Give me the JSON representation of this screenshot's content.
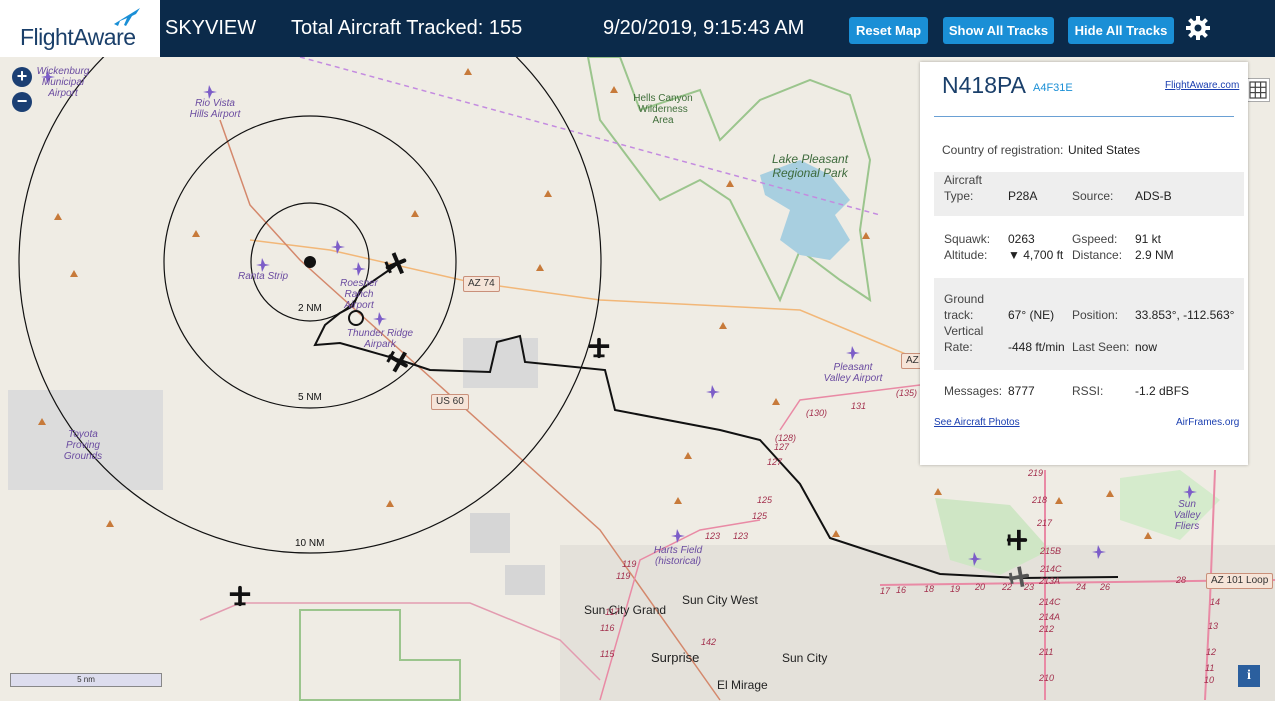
{
  "header": {
    "logo_text": "FlightAware",
    "app_name": "SKYVIEW",
    "total_tracked_label": "Total Aircraft Tracked: 155",
    "datetime": "9/20/2019, 9:15:43 AM",
    "reset_map": "Reset Map",
    "show_all_tracks": "Show All Tracks",
    "hide_all_tracks": "Hide All Tracks",
    "settings_icon": "gear-icon"
  },
  "map": {
    "zoom_in": "+",
    "zoom_out": "−",
    "scale_label": "5 nm",
    "info_button": "i",
    "range_rings": [
      "2 NM",
      "5 NM",
      "10 NM"
    ],
    "airports": [
      "Wickenburg Municipal Airport",
      "Rio Vista Hills Airport",
      "Ranta Strip",
      "Roesner Ranch Airport",
      "Thunder Ridge Airpark",
      "Pleasant Valley Airport",
      "Harts Field (historical)",
      "Sun Valley Fliers"
    ],
    "parks": [
      "Hells Canyon Wilderness Area",
      "Lake Pleasant Regional Park"
    ],
    "other_areas": [
      "Toyota Proving Grounds"
    ],
    "towns": [
      "Sun City Grand",
      "Sun City West",
      "Surprise",
      "Sun City",
      "El Mirage"
    ],
    "highways": [
      "AZ 74",
      "US 60",
      "AZ 101 Loop",
      "AZ"
    ],
    "route_numbers": [
      "(130)",
      "131",
      "(135)",
      "(128)",
      "127",
      "127",
      "125",
      "125",
      "123",
      "123",
      "119",
      "119",
      "117",
      "116",
      "115",
      "17",
      "16",
      "18",
      "19",
      "20",
      "22",
      "23",
      "24",
      "26",
      "28",
      "219",
      "218",
      "217",
      "215B",
      "214C",
      "213A",
      "214C",
      "214A",
      "212",
      "211",
      "210",
      "14",
      "13",
      "12",
      "11",
      "10",
      "142"
    ]
  },
  "panel": {
    "tail": "N418PA",
    "hex": "A4F31E",
    "flightaware_link": "FlightAware.com",
    "country_label": "Country of registration:",
    "country_value": "United States",
    "aircraft_type_label": "Aircraft Type:",
    "aircraft_type_value": "P28A",
    "source_label": "Source:",
    "source_value": "ADS-B",
    "squawk_label": "Squawk:",
    "squawk_value": "0263",
    "gspeed_label": "Gspeed:",
    "gspeed_value": "91 kt",
    "altitude_label": "Altitude:",
    "altitude_value": "▼ 4,700 ft",
    "distance_label": "Distance:",
    "distance_value": "2.9 NM",
    "ground_track_label": "Ground track:",
    "ground_track_value": "67° (NE)",
    "position_label": "Position:",
    "position_value": "33.853°, -112.563°",
    "vertical_rate_label": "Vertical Rate:",
    "vertical_rate_value": "-448 ft/min",
    "last_seen_label": "Last Seen:",
    "last_seen_value": "now",
    "messages_label": "Messages:",
    "messages_value": "8777",
    "rssi_label": "RSSI:",
    "rssi_value": "-1.2 dBFS",
    "photos_link": "See Aircraft Photos",
    "airframes_link": "AirFrames.org"
  }
}
